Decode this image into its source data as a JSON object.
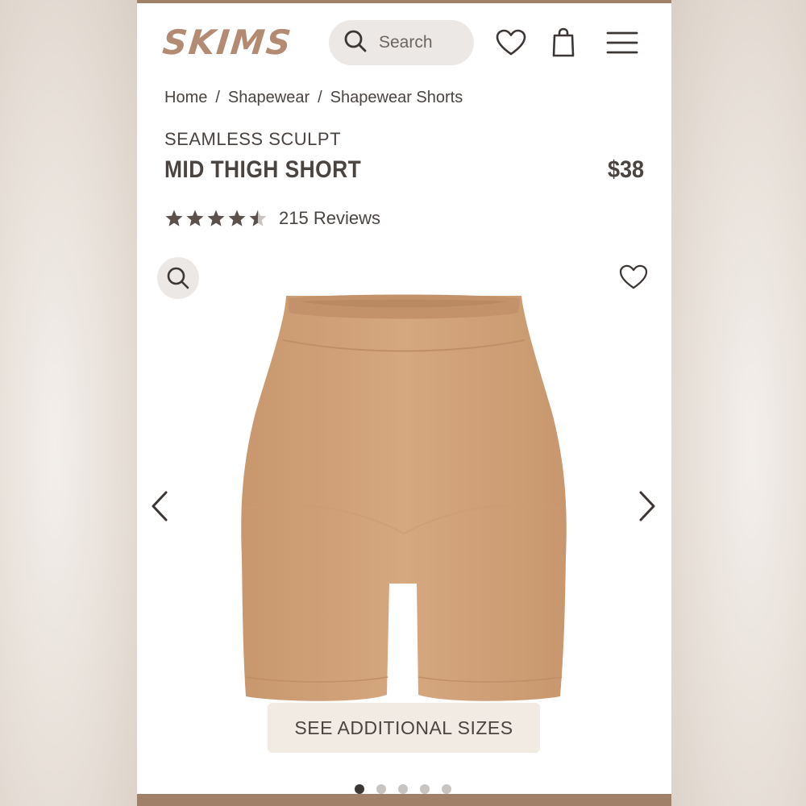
{
  "header": {
    "logo": "SKIMS",
    "search_placeholder": "Search"
  },
  "breadcrumb": [
    "Home",
    "Shapewear",
    "Shapewear Shorts"
  ],
  "breadcrumb_separator": "/",
  "product": {
    "collection": "SEAMLESS SCULPT",
    "title": "MID THIGH SHORT",
    "price": "$38",
    "rating": 4.5,
    "reviews_label": "215 Reviews"
  },
  "gallery": {
    "see_sizes_label": "SEE ADDITIONAL SIZES",
    "image_count": 5,
    "active_index": 0
  },
  "colors": {
    "brand": "#b38a72",
    "text": "#4a4441",
    "product": "#d4a57d"
  }
}
